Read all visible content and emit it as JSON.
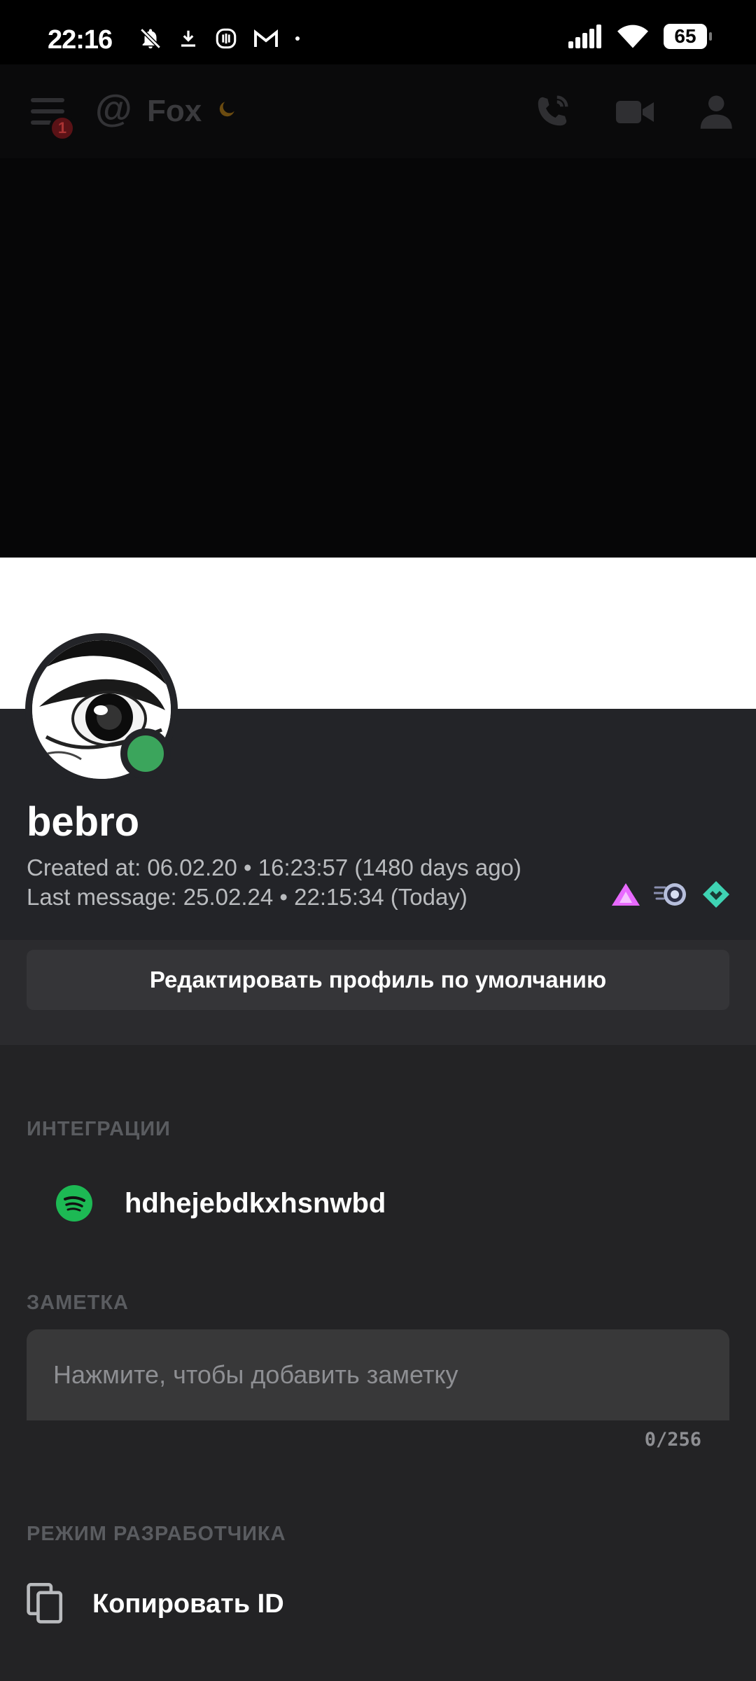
{
  "status_bar": {
    "time": "22:16",
    "battery": "65",
    "left_icons": [
      "bell-off-icon",
      "download-icon",
      "vpn-icon",
      "gmail-icon",
      "dot-icon"
    ],
    "right_icons": [
      "signal-icon",
      "wifi-icon",
      "battery-icon"
    ]
  },
  "chat_header": {
    "title": "Fox",
    "unread_badge": "1",
    "icons": [
      "menu-icon",
      "at-icon",
      "moon-icon",
      "call-icon",
      "video-icon",
      "members-icon"
    ]
  },
  "profile": {
    "username": "bebro",
    "created_at": "Created at: 06.02.20 • 16:23:57 (1480 days ago)",
    "last_message": "Last message: 25.02.24 • 22:15:34 (Today)",
    "status_color": "#3ba55c",
    "badges": [
      "hypesquad-balance-badge",
      "nitro-boost-badge",
      "hypesquad-brilliance-badge"
    ],
    "edit_button": "Редактировать профиль по умолчанию"
  },
  "integrations": {
    "label": "ИНТЕГРАЦИИ",
    "items": [
      {
        "service": "spotify-icon",
        "name": "hdhejebdkxhsnwbd"
      }
    ]
  },
  "note": {
    "label": "ЗАМЕТКА",
    "placeholder": "Нажмите, чтобы добавить заметку",
    "counter": "0/256"
  },
  "developer": {
    "label": "РЕЖИМ РАЗРАБОТЧИКА",
    "copy_id": "Копировать ID"
  }
}
